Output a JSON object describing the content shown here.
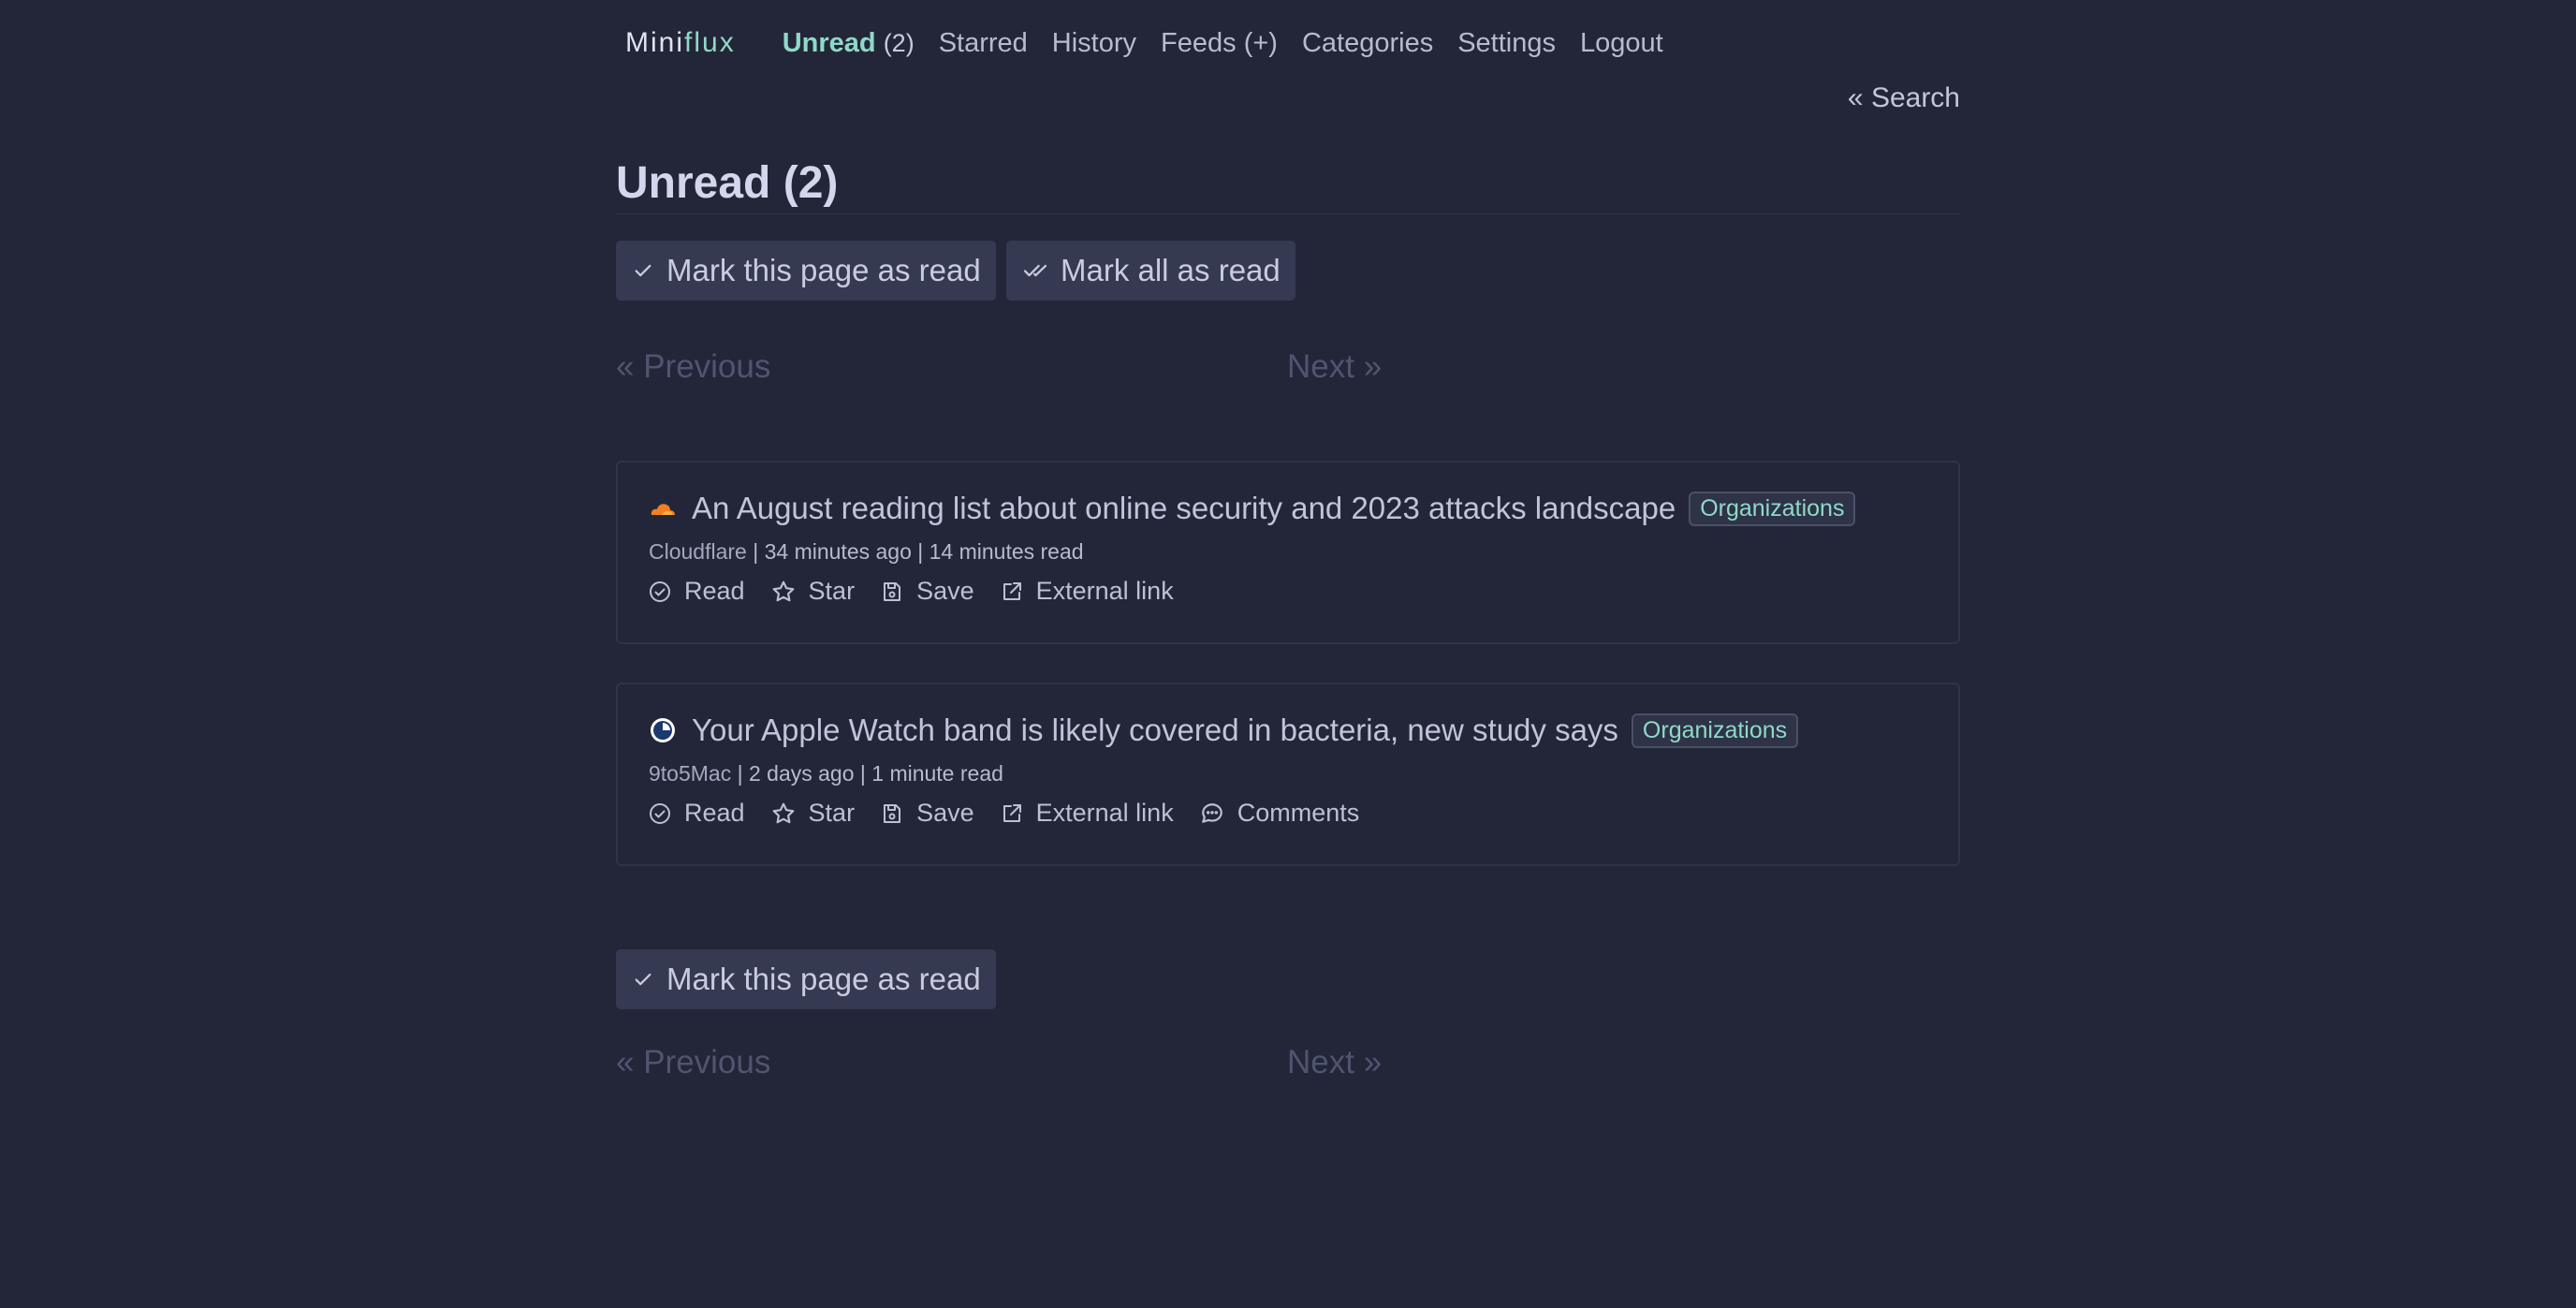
{
  "header": {
    "logo_prefix": "Mini",
    "logo_suffix": "flux",
    "nav": [
      {
        "label": "Unread",
        "count": "(2)",
        "active": true
      },
      {
        "label": "Starred"
      },
      {
        "label": "History"
      },
      {
        "label": "Feeds (+)"
      },
      {
        "label": "Categories"
      },
      {
        "label": "Settings"
      },
      {
        "label": "Logout"
      }
    ],
    "search_link": "« Search"
  },
  "page_title": "Unread (2)",
  "toolbar": {
    "mark_page_read": "Mark this page as read",
    "mark_all_read": "Mark all as read"
  },
  "pagination": {
    "previous": "« Previous",
    "next": "Next »"
  },
  "entries": [
    {
      "favicon": "cloudflare-icon",
      "title": "An August reading list about online security and 2023 attacks landscape",
      "category": "Organizations",
      "feed": "Cloudflare",
      "meta": " | 34 minutes ago | 14 minutes read",
      "actions": {
        "read": "Read",
        "star": "Star",
        "save": "Save",
        "external": "External link"
      }
    },
    {
      "favicon": "9to5mac-icon",
      "title": "Your Apple Watch band is likely covered in bacteria, new study says",
      "category": "Organizations",
      "feed": "9to5Mac",
      "meta": " | 2 days ago | 1 minute read",
      "actions": {
        "read": "Read",
        "star": "Star",
        "save": "Save",
        "external": "External link",
        "comments": "Comments"
      }
    }
  ],
  "colors": {
    "background": "#232638",
    "accent": "#8fd9c9",
    "button_bg": "#353a52",
    "disabled_text": "#4f5570"
  }
}
